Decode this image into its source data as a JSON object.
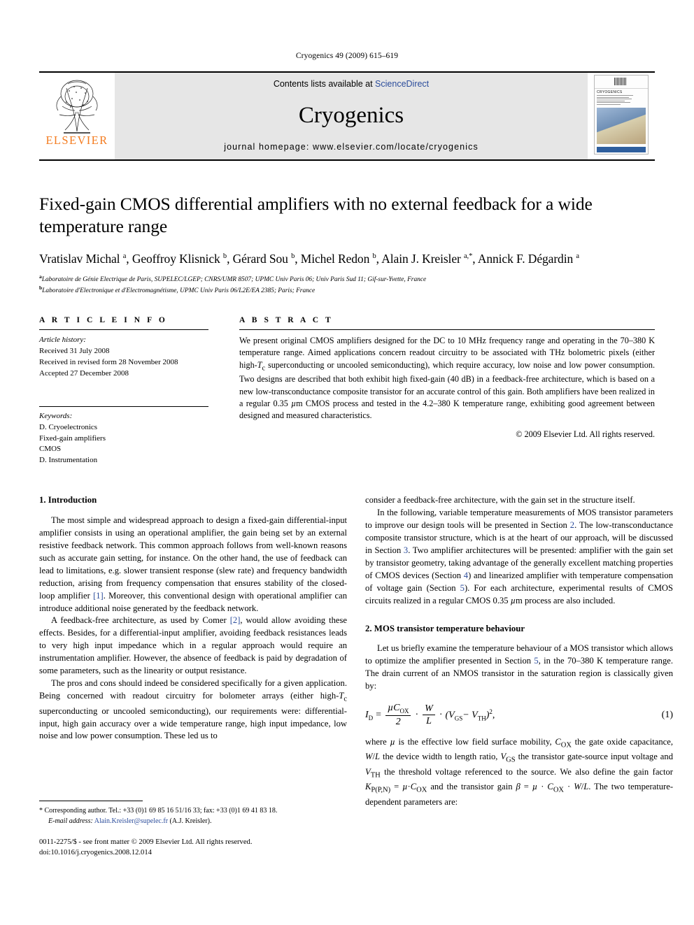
{
  "running_head": "Cryogenics 49 (2009) 615–619",
  "masthead": {
    "contents_prefix": "Contents lists available at ",
    "sciencedirect": "ScienceDirect",
    "journal_title": "Cryogenics",
    "homepage": "journal homepage: www.elsevier.com/locate/cryogenics",
    "publisher_wordmark": "ELSEVIER",
    "cover_journal_name": "CRYOGENICS"
  },
  "article": {
    "title": "Fixed-gain CMOS differential amplifiers with no external feedback for a wide temperature range",
    "authors_html": "Vratislav Michal <sup>a</sup>, Geoffroy Klisnick <sup>b</sup>, Gérard Sou <sup>b</sup>, Michel Redon <sup>b</sup>, Alain J. Kreisler <sup>a,*</sup>, Annick F. Dégardin <sup>a</sup>",
    "affiliations": [
      {
        "marker": "a",
        "text": "Laboratoire de Génie Electrique de Paris, SUPELEC/LGEP; CNRS/UMR 8507; UPMC Univ Paris 06; Univ Paris Sud 11; Gif-sur-Yvette, France"
      },
      {
        "marker": "b",
        "text": "Laboratoire d'Electronique et d'Electromagnétisme, UPMC Univ Paris 06/L2E/EA 2385; Paris; France"
      }
    ]
  },
  "article_info": {
    "label": "A R T I C L E    I N F O",
    "history_title": "Article history:",
    "history": [
      "Received 31 July 2008",
      "Received in revised form 28 November 2008",
      "Accepted 27 December 2008"
    ],
    "keywords_title": "Keywords:",
    "keywords": [
      "D. Cryoelectronics",
      "Fixed-gain amplifiers",
      "CMOS",
      "D. Instrumentation"
    ]
  },
  "abstract": {
    "label": "A B S T R A C T",
    "text": "We present original CMOS amplifiers designed for the DC to 10 MHz frequency range and operating in the 70–380 K temperature range. Aimed applications concern readout circuitry to be associated with THz bolometric pixels (either high-Tc superconducting or uncooled semiconducting), which require accuracy, low noise and low power consumption. Two designs are described that both exhibit high fixed-gain (40 dB) in a feedback-free architecture, which is based on a new low-transconductance composite transistor for an accurate control of this gain. Both amplifiers have been realized in a regular 0.35 µm CMOS process and tested in the 4.2–380 K temperature range, exhibiting good agreement between designed and measured characteristics.",
    "copyright": "© 2009 Elsevier Ltd. All rights reserved."
  },
  "body": {
    "section1_heading": "1. Introduction",
    "section1_p1": "The most simple and widespread approach to design a fixed-gain differential-input amplifier consists in using an operational amplifier, the gain being set by an external resistive feedback network. This common approach follows from well-known reasons such as accurate gain setting, for instance. On the other hand, the use of feedback can lead to limitations, e.g. slower transient response (slew rate) and frequency bandwidth reduction, arising from frequency compensation that ensures stability of the closed-loop amplifier [1]. Moreover, this conventional design with operational amplifier can introduce additional noise generated by the feedback network.",
    "section1_p2": "A feedback-free architecture, as used by Comer [2], would allow avoiding these effects. Besides, for a differential-input amplifier, avoiding feedback resistances leads to very high input impedance which in a regular approach would require an instrumentation amplifier. However, the absence of feedback is paid by degradation of some parameters, such as the linearity or output resistance.",
    "section1_p3": "The pros and cons should indeed be considered specifically for a given application. Being concerned with readout circuitry for bolometer arrays (either high-Tc superconducting or uncooled semiconducting), our requirements were: differential-input, high gain accuracy over a wide temperature range, high input impedance, low noise and low power consumption. These led us to",
    "section1_p3_cont": "consider a feedback-free architecture, with the gain set in the structure itself.",
    "section1_p4": "In the following, variable temperature measurements of MOS transistor parameters to improve our design tools will be presented in Section 2. The low-transconductance composite transistor structure, which is at the heart of our approach, will be discussed in Section 3. Two amplifier architectures will be presented: amplifier with the gain set by transistor geometry, taking advantage of the generally excellent matching properties of CMOS devices (Section 4) and linearized amplifier with temperature compensation of voltage gain (Section 5). For each architecture, experimental results of CMOS circuits realized in a regular CMOS 0.35 µm process are also included.",
    "section2_heading": "2. MOS transistor temperature behaviour",
    "section2_p1": "Let us briefly examine the temperature behaviour of a MOS transistor which allows to optimize the amplifier presented in Section 5, in the 70–380 K temperature range. The drain current of an NMOS transistor in the saturation region is classically given by:",
    "equation1": {
      "lhs": "I",
      "lhs_sub": "D",
      "eq": "=",
      "num": "µC",
      "num_sub": "OX",
      "den": "2",
      "dot1": "·",
      "frac2_num": "W",
      "frac2_den": "L",
      "dot2": "·",
      "paren": "(V",
      "vgs_sub": "GS",
      "minus": "− V",
      "vth_sub": "TH",
      "close": ")",
      "power": "2",
      "comma": ",",
      "number": "(1)"
    },
    "section2_p2": "where µ is the effective low field surface mobility, COX the gate oxide capacitance, W/L the device width to length ratio, VGS the transistor gate-source input voltage and VTH the threshold voltage referenced to the source. We also define the gain factor KP(P,N) = µ·COX and the transistor gain β = µ · COX · W/L. The two temperature-dependent parameters are:"
  },
  "footnotes": {
    "corresponding": "* Corresponding author. Tel.: +33 (0)1 69 85 16 51/16 33; fax: +33 (0)1 69 41 83 18.",
    "email_label": "E-mail address:",
    "email": "Alain.Kreisler@supelec.fr",
    "email_suffix": "(A.J. Kreisler).",
    "issn_line": "0011-2275/$ - see front matter © 2009 Elsevier Ltd. All rights reserved.",
    "doi_line": "doi:10.1016/j.cryogenics.2008.12.014"
  },
  "colors": {
    "link": "#2b4c9b",
    "elsevier_orange": "#f47c20",
    "band_grey": "#e6e6e6"
  }
}
